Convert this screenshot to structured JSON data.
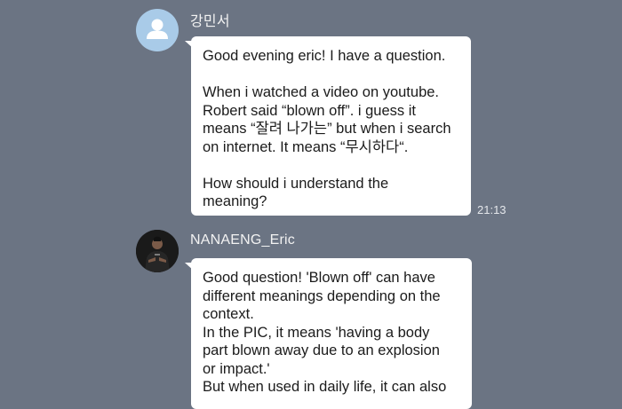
{
  "messages": [
    {
      "sender": "강민서",
      "avatar_icon": "default-person-icon",
      "paragraphs": [
        "Good evening eric! I have a question.",
        "When i watched a video on youtube.\nRobert said “blown off”. i guess it\nmeans “잘려 나가는” but when i search\non internet. It means “무시하다“.",
        "How should i understand the\nmeaning?"
      ],
      "time": "21:13"
    },
    {
      "sender": "NANAENG_Eric",
      "avatar_icon": "profile-photo-icon",
      "paragraphs": [
        "Good question! 'Blown off' can have\ndifferent meanings depending on the\ncontext.\nIn the PIC, it means 'having a body\npart blown away due to an explosion\nor impact.'\nBut when used in daily life, it can also"
      ]
    }
  ],
  "colors": {
    "background": "#6b7483",
    "bubble": "#ffffff",
    "default_avatar": "#a9cbe8"
  }
}
